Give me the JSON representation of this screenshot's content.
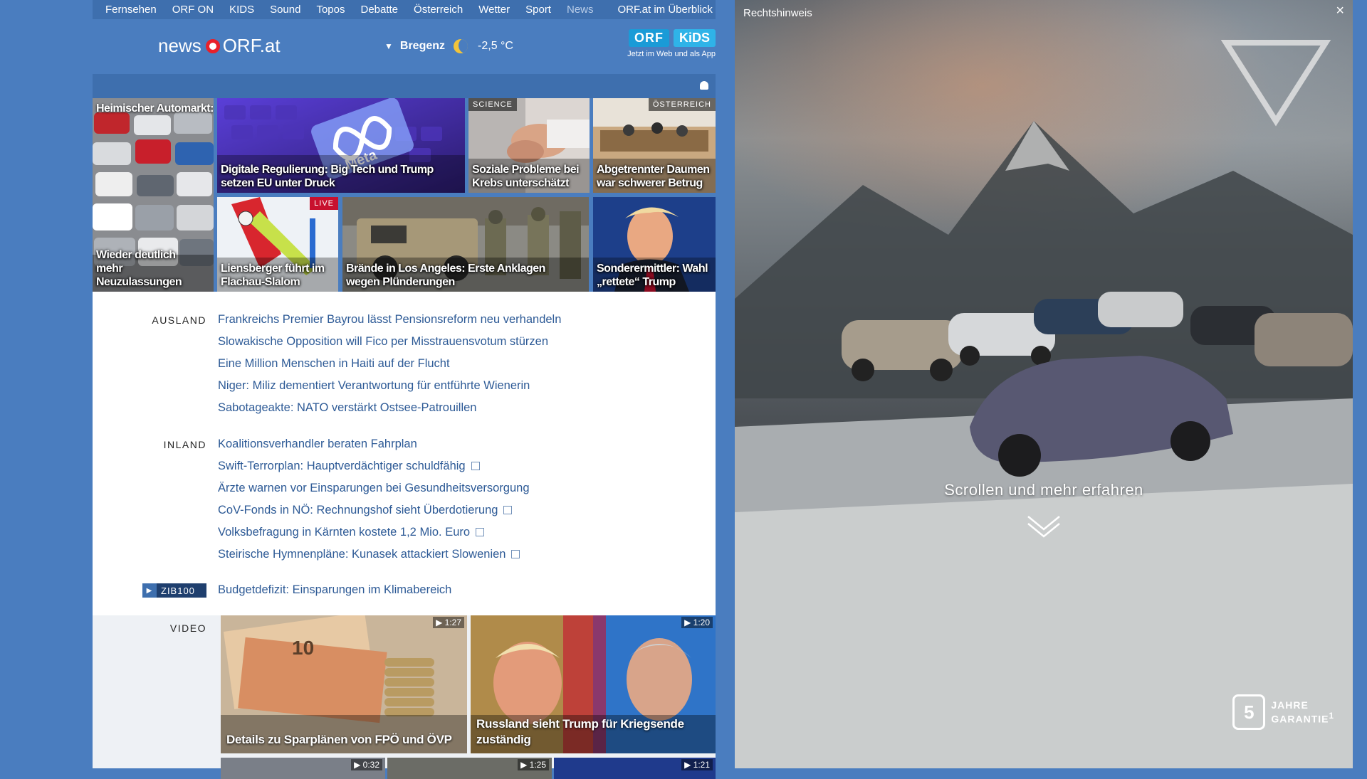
{
  "nav": {
    "items": [
      "Fernsehen",
      "ORF ON",
      "KIDS",
      "Sound",
      "Topos",
      "Debatte",
      "Österreich",
      "Wetter",
      "Sport",
      "News"
    ],
    "overview": "ORF.at im Überblick"
  },
  "header": {
    "logo_news": "news",
    "logo_orf": "ORF.at",
    "location": "Bregenz",
    "temperature": "-2,5 °C",
    "kids_badge_1": "ORF",
    "kids_badge_2": "KiDS",
    "kids_tagline": "Jetzt im Web und als App"
  },
  "tiles": {
    "t1_top": "Heimischer Automarkt:",
    "t1_cap": "Wieder deutlich mehr Neuzulassungen",
    "t2_cap": "Digitale Regulierung: Big Tech und Trump setzen EU unter Druck",
    "t3_tag": "SCIENCE",
    "t3_cap": "Soziale Probleme bei Krebs unterschätzt",
    "t4_tag": "ÖSTERREICH",
    "t4_cap": "Abgetrennter Daumen war schwerer Betrug",
    "t5_tag": "LIVE",
    "t5_cap": "Liensberger führt im Flachau-Slalom",
    "t6_cap": "Brände in Los Angeles: Erste Anklagen wegen Plünderungen",
    "t7_cap": "Sonderermittler: Wahl „rettete“ Trump"
  },
  "ausland": {
    "label": "AUSLAND",
    "items": [
      "Frankreichs Premier Bayrou lässt Pensionsreform neu verhandeln",
      "Slowakische Opposition will Fico per Misstrauensvotum stürzen",
      "Eine Million Menschen in Haiti auf der Flucht",
      "Niger: Miliz dementiert Verantwortung für entführte Wienerin",
      "Sabotageakte: NATO verstärkt Ostsee-Patrouillen"
    ]
  },
  "inland": {
    "label": "INLAND",
    "items": [
      "Koalitionsverhandler beraten Fahrplan",
      "Swift-Terrorplan: Hauptverdächtiger schuldfähig",
      "Ärzte warnen vor Einsparungen bei Gesundheitsversorgung",
      "CoV-Fonds in NÖ: Rechnungshof sieht Überdotierung",
      "Volksbefragung in Kärnten kostete 1,2 Mio. Euro",
      "Steirische Hymnenpläne: Kunasek attackiert Slowenien"
    ]
  },
  "zib": {
    "label": "ZIB100",
    "headline": "Budgetdefizit: Einsparungen im Klimabereich"
  },
  "video": {
    "label": "VIDEO",
    "v1_duration": "1:27",
    "v1_caption": "Details zu Sparplänen von FPÖ und ÖVP",
    "v2_duration": "1:20",
    "v2_caption": "Russland sieht Trump für Kriegsende zuständig",
    "v3_duration": "0:32",
    "v4_duration": "1:25",
    "v5_duration": "1:21"
  },
  "ad": {
    "title": "Rechtshinweis",
    "close": "×",
    "cta": "Scrollen und mehr erfahren",
    "guarantee_number": "5",
    "guarantee_text_1": "JAHRE",
    "guarantee_text_2": "GARANTIE",
    "guarantee_sup": "1"
  }
}
